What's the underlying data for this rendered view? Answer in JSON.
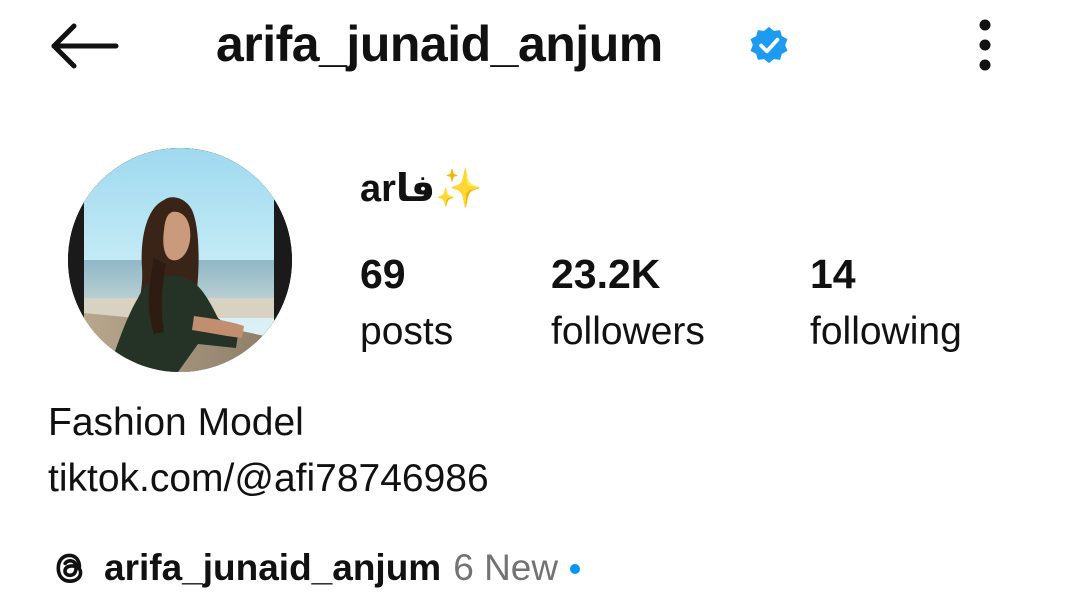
{
  "header": {
    "title": "arifa_junaid_anjum",
    "verified": true,
    "icons": {
      "back": "arrow-left-icon",
      "verified": "verified-badge-icon",
      "more": "more-vertical-icon"
    }
  },
  "profile": {
    "display_name": "arفا✨",
    "stats": [
      {
        "count": "69",
        "label": "posts"
      },
      {
        "count": "23.2K",
        "label": "followers"
      },
      {
        "count": "14",
        "label": "following"
      }
    ],
    "bio": {
      "category": "Fashion Model",
      "link": "tiktok.com/@afi78746986"
    },
    "threads": {
      "icon": "threads-icon",
      "handle": "arifa_junaid_anjum",
      "new_label": "6 New"
    }
  },
  "colors": {
    "text": "#111111",
    "muted": "#737373",
    "accent": "#0095f6",
    "verified": "#1d9bf0",
    "background": "#ffffff"
  }
}
